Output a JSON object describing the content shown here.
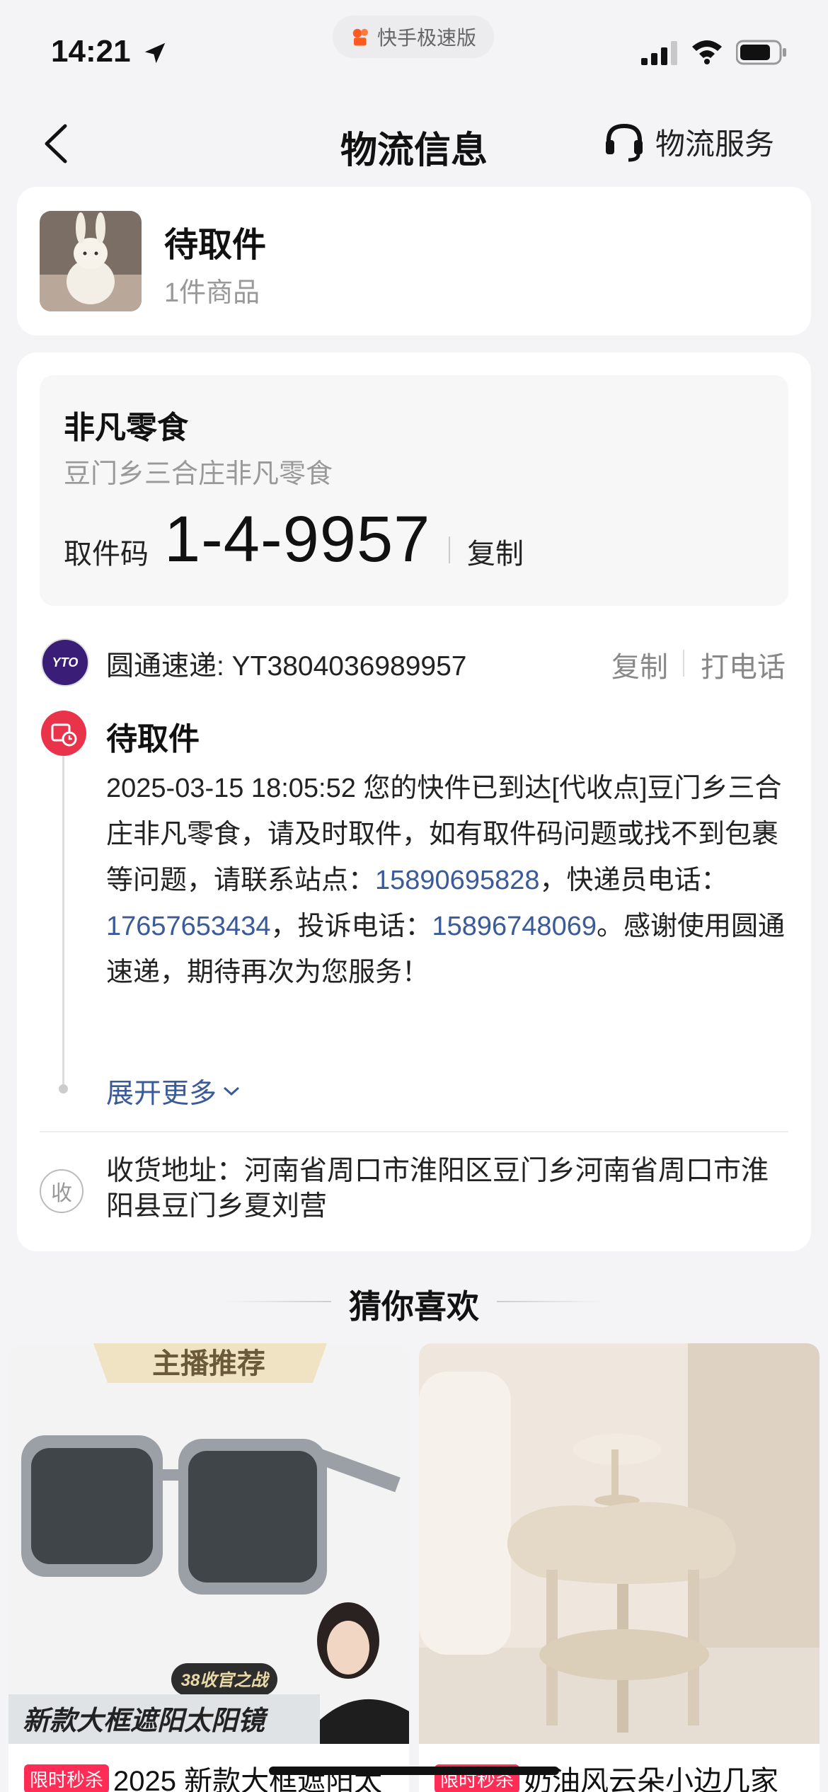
{
  "status_bar": {
    "time": "14:21",
    "app_name": "快手极速版",
    "battery_level": 0.8
  },
  "nav": {
    "title": "物流信息",
    "service_label": "物流服务"
  },
  "order": {
    "status": "待取件",
    "item_count": "1件商品"
  },
  "pickup": {
    "station_name": "非凡零食",
    "station_address": "豆门乡三合庄非凡零食",
    "code_label": "取件码",
    "code_value": "1-4-9957",
    "copy_label": "复制"
  },
  "carrier": {
    "text": "圆通速递: YT3804036989957",
    "copy_label": "复制",
    "call_label": "打电话",
    "logo_text": "YTO"
  },
  "tracking": {
    "event_title": "待取件",
    "desc_part1": "2025-03-15 18:05:52 您的快件已到达[代收点]豆门乡三合庄非凡零食，请及时取件，如有取件码问题或找不到包裹等问题，请联系站点：",
    "phone_station": "15890695828",
    "desc_part2": "，快递员电话：",
    "phone_courier": "17657653434",
    "desc_part3": "，投诉电话：",
    "phone_complaint": "15896748069",
    "desc_part4": "。感谢使用圆通速递，期待再次为您服务！",
    "expand_label": "展开更多"
  },
  "address": {
    "icon_label": "收",
    "text": "收货地址：河南省周口市淮阳区豆门乡河南省周口市淮阳县豆门乡夏刘营"
  },
  "recommend": {
    "title": "猜你喜欢",
    "products": [
      {
        "banner": "主播推荐",
        "badge": "38收官之战",
        "caption": "新款大框遮阳太阳镜",
        "tag": "限时秒杀",
        "name": "2025 新款大框遮阳太"
      },
      {
        "tag": "限时秒杀",
        "name": "奶油风云朵小边几家"
      }
    ]
  },
  "colors": {
    "accent_red": "#e9334b",
    "link_blue": "#3b5a99",
    "flash_tag": "#ff2d55"
  }
}
